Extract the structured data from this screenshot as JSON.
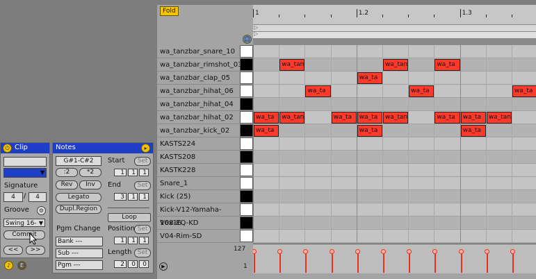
{
  "clip_panel": {
    "title": "Clip",
    "signature_label": "Signature",
    "sig_num": "4",
    "sig_den": "4",
    "groove_label": "Groove",
    "groove_value": "Swing 16-",
    "commit_label": "Commit",
    "prev_label": "<<",
    "next_label": ">>"
  },
  "notes_panel": {
    "title": "Notes",
    "range": "G#1-C#2",
    "div2": ":2",
    "mul2": "*2",
    "rev": "Rev",
    "inv": "Inv",
    "legato": "Legato",
    "dupl": "Dupl.Region",
    "pgm_change": "Pgm Change",
    "bank": "Bank ---",
    "sub": "Sub ---",
    "pgm": "Pgm ---",
    "start_label": "Start",
    "end_label": "End",
    "loop_label": "Loop",
    "position_label": "Position",
    "length_label": "Length",
    "set": "Set",
    "start": [
      "1",
      "1",
      "1"
    ],
    "end": [
      "3",
      "1",
      "1"
    ],
    "position": [
      "1",
      "1",
      "1"
    ],
    "length": [
      "2",
      "0",
      "0"
    ]
  },
  "fold_label": "Fold",
  "ruler_labels": [
    "1",
    "1.2",
    "1.3"
  ],
  "velocity": {
    "max": "127",
    "min": "1"
  },
  "rows": [
    {
      "name": "wa_tanzbar_snare_10",
      "key": "white"
    },
    {
      "name": "wa_tanzbar_rimshot_03",
      "key": "black"
    },
    {
      "name": "wa_tanzbar_clap_05",
      "key": "white"
    },
    {
      "name": "wa_tanzbar_hihat_06",
      "key": "white"
    },
    {
      "name": "wa_tanzbar_hihat_04",
      "key": "black"
    },
    {
      "name": "wa_tanzbar_hihat_02",
      "key": "white"
    },
    {
      "name": "wa_tanzbar_kick_02",
      "key": "black"
    },
    {
      "name": "KASTS224",
      "key": "white"
    },
    {
      "name": "KASTS208",
      "key": "black"
    },
    {
      "name": "KASTK228",
      "key": "white"
    },
    {
      "name": "Snare_1",
      "key": "white"
    },
    {
      "name": "Kick (25)",
      "key": "black"
    },
    {
      "name": "Kick-V12-Yamaha-16x16",
      "key": "white"
    },
    {
      "name": "V08-EQ-KD",
      "key": "black"
    },
    {
      "name": "V04-Rim-SD",
      "key": "white"
    }
  ],
  "notes": [
    {
      "row": 1,
      "step": 1,
      "label": "wa_tan"
    },
    {
      "row": 1,
      "step": 5,
      "label": "wa_tan"
    },
    {
      "row": 1,
      "step": 7,
      "label": "wa_ta"
    },
    {
      "row": 2,
      "step": 4,
      "label": "wa_ta"
    },
    {
      "row": 3,
      "step": 2,
      "label": "wa_ta"
    },
    {
      "row": 3,
      "step": 6,
      "label": "wa_ta"
    },
    {
      "row": 3,
      "step": 10,
      "label": "wa_ta"
    },
    {
      "row": 5,
      "step": 0,
      "label": "wa_ta"
    },
    {
      "row": 5,
      "step": 1,
      "label": "wa_tan"
    },
    {
      "row": 5,
      "step": 3,
      "label": "wa_ta"
    },
    {
      "row": 5,
      "step": 4,
      "label": "wa_ta"
    },
    {
      "row": 5,
      "step": 5,
      "label": "wa_tan"
    },
    {
      "row": 5,
      "step": 7,
      "label": "wa_ta"
    },
    {
      "row": 5,
      "step": 8,
      "label": "wa_ta"
    },
    {
      "row": 5,
      "step": 9,
      "label": "wa_tan"
    },
    {
      "row": 6,
      "step": 0,
      "label": "wa_ta"
    },
    {
      "row": 6,
      "step": 4,
      "label": "wa_ta"
    },
    {
      "row": 6,
      "step": 8,
      "label": "wa_ta"
    }
  ],
  "velocity_steps": [
    0,
    1,
    2,
    3,
    4,
    5,
    6,
    7,
    8,
    9,
    10
  ],
  "colors": {
    "note": "#ff3a2a",
    "title_bar": "#1f3ec8",
    "fold": "#f4c400"
  }
}
